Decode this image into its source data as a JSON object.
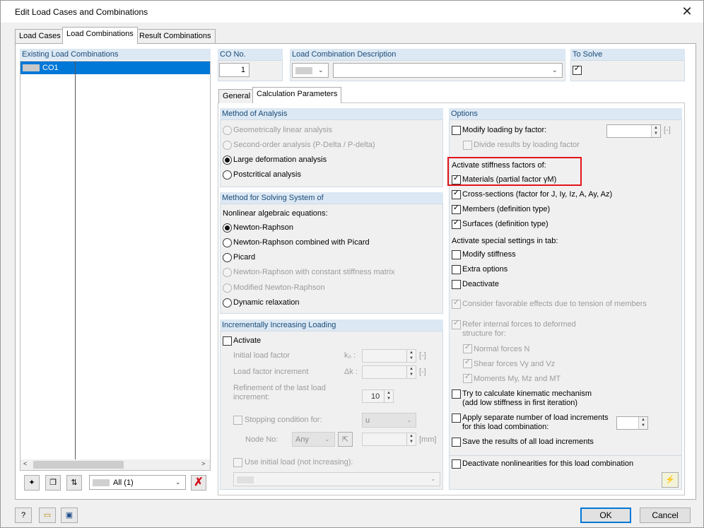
{
  "window": {
    "title": "Edit Load Cases and Combinations"
  },
  "tabs": [
    "Load Cases",
    "Load Combinations",
    "Result Combinations"
  ],
  "left_panel": {
    "header": "Existing Load Combinations",
    "items": [
      {
        "id": "CO1"
      }
    ],
    "filter_value": "All (1)"
  },
  "co_no": {
    "header": "CO No.",
    "value": "1"
  },
  "description": {
    "header": "Load Combination Description",
    "value": ""
  },
  "to_solve": {
    "header": "To Solve",
    "checked": true
  },
  "subtabs": [
    "General",
    "Calculation Parameters"
  ],
  "method": {
    "header": "Method of Analysis",
    "options": [
      {
        "label": "Geometrically linear analysis",
        "state": "disabled"
      },
      {
        "label": "Second-order analysis (P-Delta / P-delta)",
        "state": "disabled"
      },
      {
        "label": "Large deformation analysis",
        "state": "selected"
      },
      {
        "label": "Postcritical analysis",
        "state": "enabled"
      }
    ]
  },
  "solving": {
    "header": "Method for Solving System of",
    "sublabel": "Nonlinear algebraic equations:",
    "options": [
      {
        "label": "Newton-Raphson",
        "state": "selected"
      },
      {
        "label": "Newton-Raphson combined with Picard",
        "state": "enabled"
      },
      {
        "label": "Picard",
        "state": "enabled"
      },
      {
        "label": "Newton-Raphson with constant stiffness matrix",
        "state": "disabled"
      },
      {
        "label": "Modified Newton-Raphson",
        "state": "disabled"
      },
      {
        "label": "Dynamic relaxation",
        "state": "enabled"
      }
    ]
  },
  "incremental": {
    "header": "Incrementally Increasing Loading",
    "activate": "Activate",
    "initial_factor": "Initial load factor",
    "k0": "k₀ :",
    "unit1": "[-]",
    "increment": "Load factor increment",
    "dk": "Δk :",
    "unit2": "[-]",
    "refinement1": "Refinement of the last load",
    "refinement2": "increment:",
    "refinement_value": "10",
    "stopping": "Stopping condition for:",
    "stopping_value": "u",
    "node": "Node No:",
    "node_value": "Any",
    "unit3": "[mm]",
    "use_initial": "Use initial load (not increasing):"
  },
  "options": {
    "header": "Options",
    "modify_loading": "Modify loading by factor:",
    "unit": "[-]",
    "divide": "Divide results by loading factor",
    "activate_stiffness": "Activate stiffness factors of:",
    "materials": "Materials (partial factor γM)",
    "cross": "Cross-sections (factor for J, Iy, Iz, A, Ay, Az)",
    "members": "Members (definition type)",
    "surfaces": "Surfaces (definition type)",
    "special": "Activate special settings in tab:",
    "modify_stiffness": "Modify stiffness",
    "extra": "Extra options",
    "deactivate": "Deactivate",
    "favorable": "Consider favorable effects due to tension of members",
    "refer1": "Refer internal forces to deformed",
    "refer2": "structure for:",
    "normal": "Normal forces N",
    "shear": "Shear forces Vy and Vz",
    "moments": "Moments My, Mz and MT",
    "kin1": "Try to calculate kinematic mechanism",
    "kin2": "(add low stiffness in first iteration)",
    "apply1": "Apply separate number of load increments",
    "apply2": "for this load combination:",
    "save": "Save the results of all load increments",
    "deact_nl": "Deactivate nonlinearities for this load combination"
  },
  "buttons": {
    "ok": "OK",
    "cancel": "Cancel"
  }
}
